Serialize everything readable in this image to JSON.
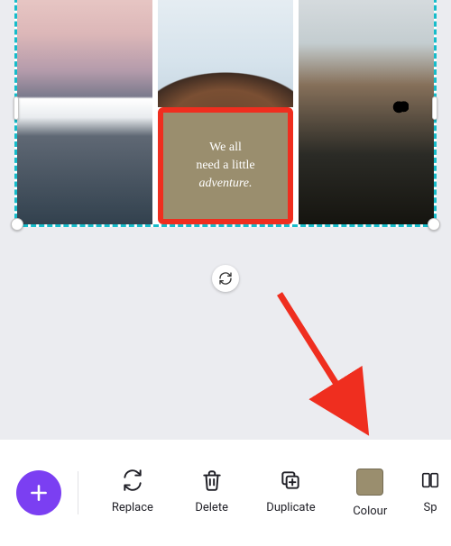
{
  "canvas": {
    "quote": {
      "line1": "We all",
      "line2": "need a little",
      "line3_italic": "adventure."
    },
    "quote_bg_color": "#9a8e6e"
  },
  "rotate": {
    "name": "rotate"
  },
  "fab": {
    "name": "add"
  },
  "toolbar": {
    "replace": "Replace",
    "delete": "Delete",
    "duplicate": "Duplicate",
    "colour": "Colour",
    "spacing": "Spacing",
    "colour_swatch": "#9a8e6e"
  }
}
